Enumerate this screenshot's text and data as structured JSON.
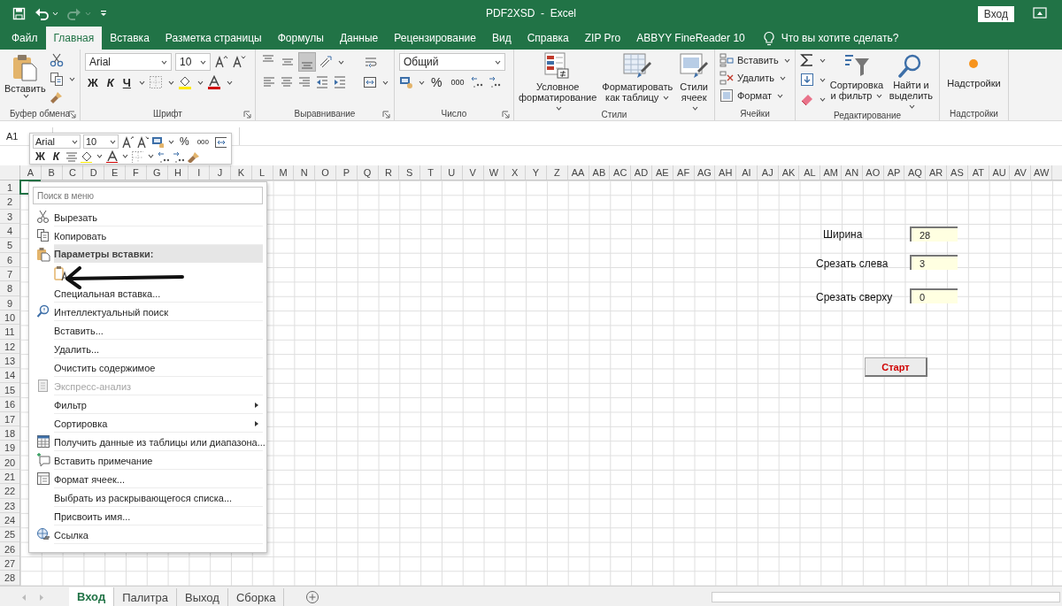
{
  "title_bar": {
    "title": "PDF2XSD  -  Excel",
    "sign_in": "Вход"
  },
  "tabs": [
    {
      "label": "Файл",
      "selected": false
    },
    {
      "label": "Главная",
      "selected": true
    },
    {
      "label": "Вставка",
      "selected": false
    },
    {
      "label": "Разметка страницы",
      "selected": false
    },
    {
      "label": "Формулы",
      "selected": false
    },
    {
      "label": "Данные",
      "selected": false
    },
    {
      "label": "Рецензирование",
      "selected": false
    },
    {
      "label": "Вид",
      "selected": false
    },
    {
      "label": "Справка",
      "selected": false
    },
    {
      "label": "ZIP Pro",
      "selected": false
    },
    {
      "label": "ABBYY FineReader 10",
      "selected": false
    }
  ],
  "tell_me": "Что вы хотите сделать?",
  "ribbon": {
    "clipboard": {
      "label": "Буфер обмена",
      "paste": "Вставить"
    },
    "font": {
      "label": "Шрифт",
      "font_name": "Arial",
      "font_size": "10",
      "bold": "Ж",
      "italic": "К",
      "underline": "Ч"
    },
    "alignment": {
      "label": "Выравнивание",
      "vertical": [
        {
          "selected": false
        },
        {
          "selected": false
        },
        {
          "selected": true
        }
      ]
    },
    "number": {
      "label": "Число",
      "format": "Общий",
      "percent": "%",
      "thousands": "000"
    },
    "styles": {
      "label": "Стили",
      "buttons": [
        "Условное форматирование",
        "Форматировать как таблицу",
        "Стили ячеек"
      ]
    },
    "cells": {
      "label": "Ячейки",
      "buttons": [
        "Вставить",
        "Удалить",
        "Формат"
      ]
    },
    "editing": {
      "label": "Редактирование",
      "buttons": [
        "Сортировка и фильтр",
        "Найти и выделить"
      ]
    },
    "addins": {
      "label": "Надстройки",
      "button": "Надстройки"
    }
  },
  "name_box": "A1",
  "mini_toolbar": {
    "font_name": "Arial",
    "font_size": "10",
    "bold": "Ж",
    "italic": "К",
    "percent": "%",
    "thousands": "000"
  },
  "columns": [
    "A",
    "B",
    "C",
    "D",
    "E",
    "F",
    "G",
    "H",
    "I",
    "J",
    "K",
    "L",
    "M",
    "N",
    "O",
    "P",
    "Q",
    "R",
    "S",
    "T",
    "U",
    "V",
    "W",
    "X",
    "Y",
    "Z",
    "AA",
    "AB",
    "AC",
    "AD",
    "AE",
    "AF",
    "AG",
    "AH",
    "AI",
    "AJ",
    "AK",
    "AL",
    "AM",
    "AN",
    "AO",
    "AP",
    "AQ",
    "AR",
    "AS",
    "AT",
    "AU",
    "AV",
    "AW"
  ],
  "rows": [
    "1",
    "2",
    "3",
    "4",
    "5",
    "6",
    "7",
    "8",
    "9",
    "10",
    "11",
    "12",
    "13",
    "14",
    "15",
    "16",
    "17",
    "18",
    "19",
    "20",
    "21",
    "22",
    "23",
    "24",
    "25",
    "26",
    "27",
    "28"
  ],
  "context_menu": {
    "search_placeholder": "Поиск в меню",
    "items": [
      {
        "kind": "item",
        "label": "Вырезать",
        "disabled": false,
        "submenu": false
      },
      {
        "kind": "item",
        "label": "Копировать",
        "disabled": false,
        "submenu": false
      },
      {
        "kind": "header",
        "label": "Параметры вставки:"
      },
      {
        "kind": "paste-option"
      },
      {
        "kind": "item",
        "label": "Специальная вставка...",
        "disabled": false,
        "submenu": false
      },
      {
        "kind": "item",
        "label": "Интеллектуальный поиск",
        "disabled": false,
        "submenu": false
      },
      {
        "kind": "item",
        "label": "Вставить...",
        "disabled": false,
        "submenu": false
      },
      {
        "kind": "item",
        "label": "Удалить...",
        "disabled": false,
        "submenu": false
      },
      {
        "kind": "item",
        "label": "Очистить содержимое",
        "disabled": false,
        "submenu": false
      },
      {
        "kind": "item",
        "label": "Экспресс-анализ",
        "disabled": true,
        "submenu": false
      },
      {
        "kind": "item",
        "label": "Фильтр",
        "disabled": false,
        "submenu": true
      },
      {
        "kind": "item",
        "label": "Сортировка",
        "disabled": false,
        "submenu": true
      },
      {
        "kind": "item",
        "label": "Получить данные из таблицы или диапазона...",
        "disabled": false,
        "submenu": false
      },
      {
        "kind": "item",
        "label": "Вставить примечание",
        "disabled": false,
        "submenu": false
      },
      {
        "kind": "item",
        "label": "Формат ячеек...",
        "disabled": false,
        "submenu": false
      },
      {
        "kind": "item",
        "label": "Выбрать из раскрывающегося списка...",
        "disabled": false,
        "submenu": false
      },
      {
        "kind": "item",
        "label": "Присвоить имя...",
        "disabled": false,
        "submenu": false
      },
      {
        "kind": "item",
        "label": "Ссылка",
        "disabled": false,
        "submenu": false
      }
    ]
  },
  "sheet_form": {
    "fields": [
      {
        "label": "Ширина",
        "value": "28"
      },
      {
        "label": "Срезать слева",
        "value": "3"
      },
      {
        "label": "Срезать сверху",
        "value": "0"
      }
    ],
    "button": "Старт"
  },
  "sheet_tabs": [
    {
      "label": "Вход",
      "selected": true
    },
    {
      "label": "Палитра",
      "selected": false
    },
    {
      "label": "Выход",
      "selected": false
    },
    {
      "label": "Сборка",
      "selected": false
    }
  ]
}
